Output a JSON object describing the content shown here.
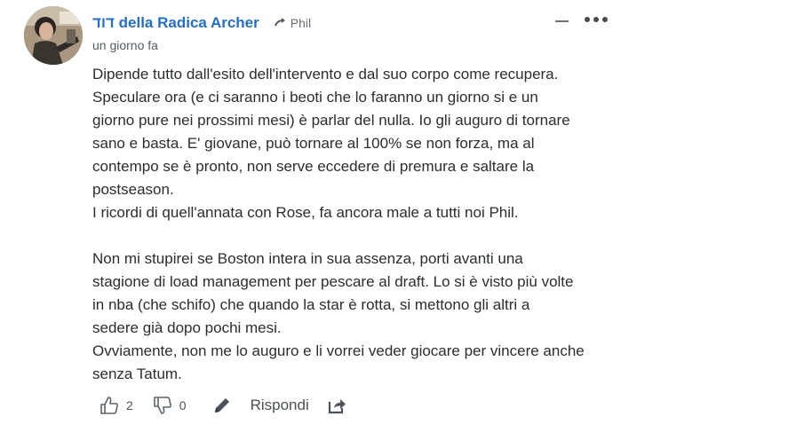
{
  "comment": {
    "author": "דוד della Radica Archer",
    "reply_to": "Phil",
    "timestamp": "un giorno fa",
    "paragraphs": [
      [
        "Dipende tutto dall'esito dell'intervento e dal suo corpo come recupera.",
        "Speculare ora (e ci saranno i beoti che lo faranno un giorno si e un",
        "giorno pure nei prossimi mesi) è parlar del nulla. Io gli auguro di tornare",
        "sano e basta. E' giovane, può tornare al 100% se non forza, ma al",
        "contempo se è pronto, non serve eccedere di premura e saltare la",
        "postseason.",
        "I ricordi di quell'annata con Rose, fa ancora male a tutti noi Phil."
      ],
      [
        "Non mi stupirei se Boston intera in sua assenza, porti avanti una",
        "stagione di load management per pescare al draft. Lo si è visto più volte",
        "in nba (che schifo) che quando la star è rotta, si mettono gli altri a",
        "sedere già dopo pochi mesi.",
        "Ovviamente, non me lo auguro e li vorrei veder giocare per vincere anche",
        "senza Tatum."
      ]
    ]
  },
  "actions": {
    "upvotes": "2",
    "downvotes": "0",
    "reply_label": "Rispondi"
  },
  "colors": {
    "author": "#1f6fd1",
    "text": "#2a2e2e",
    "muted": "#555d66"
  },
  "icons": [
    "avatar",
    "reply-arrow-icon",
    "collapse-icon",
    "more-options-icon",
    "thumbs-up-icon",
    "thumbs-down-icon",
    "pencil-icon",
    "share-icon"
  ]
}
